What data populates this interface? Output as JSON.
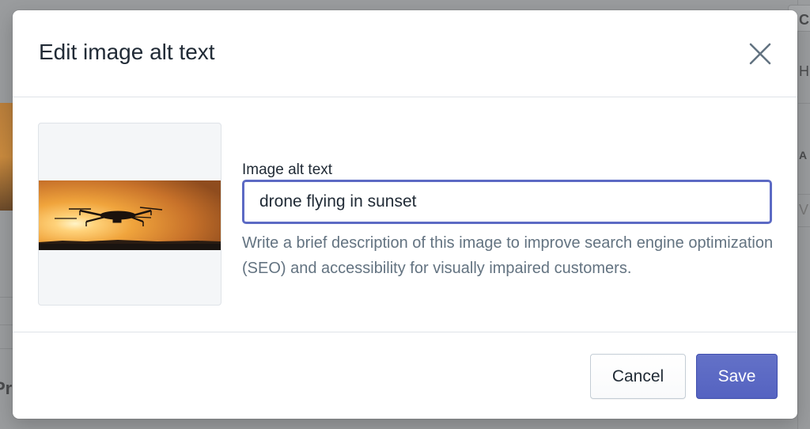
{
  "modal": {
    "title": "Edit image alt text",
    "close_icon": "close-icon",
    "image": {
      "description": "drone silhouette against orange sunset sky"
    },
    "field": {
      "label": "Image alt text",
      "value": "drone flying in sunset",
      "help_text": "Write a brief description of this image to improve search engine optimization (SEO) and accessibility for visually impaired customers."
    },
    "footer": {
      "cancel_label": "Cancel",
      "save_label": "Save"
    }
  },
  "background": {
    "left_text": "Pri",
    "right_texts": [
      "C",
      "H",
      "A",
      "V"
    ]
  },
  "colors": {
    "accent": "#5c6ac4",
    "text": "#212b36",
    "subdued": "#637381",
    "border": "#dfe3e8",
    "overlay": "#9a9c9e"
  }
}
